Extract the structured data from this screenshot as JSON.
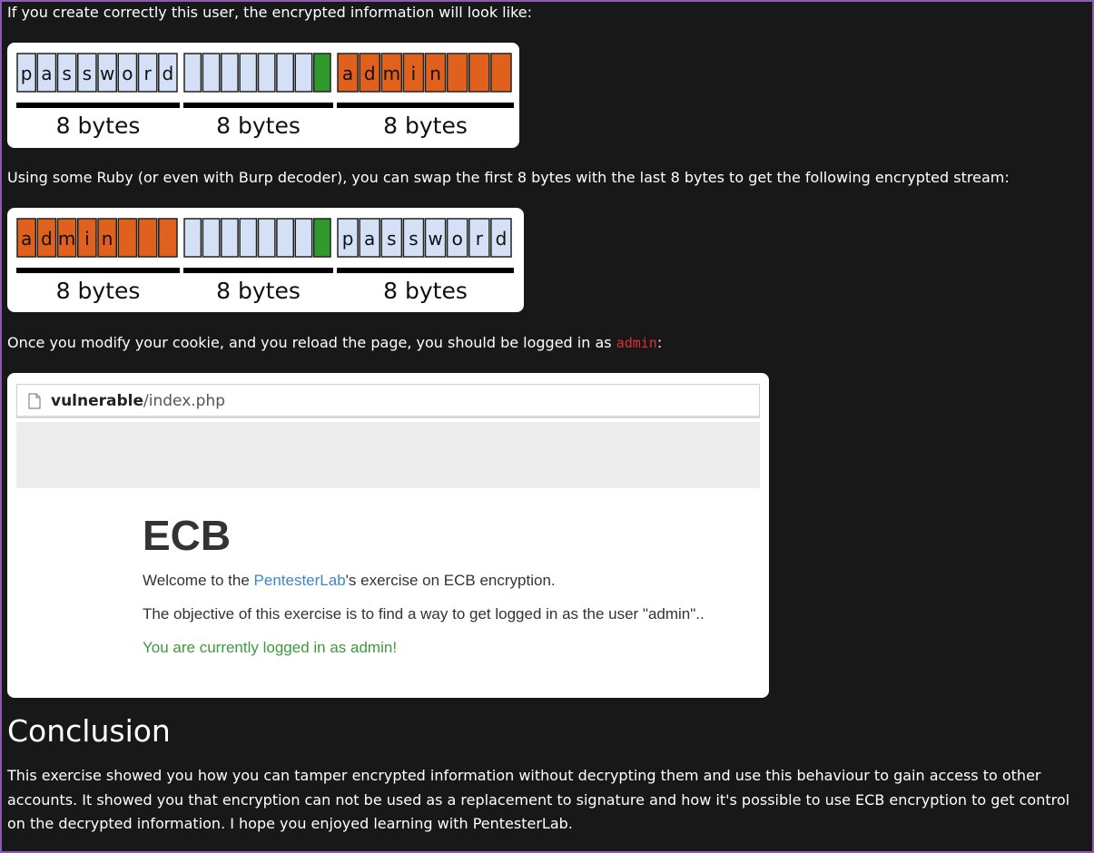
{
  "intro_text": "If you create correctly this user, the encrypted information will look like:",
  "diagram1": {
    "cells": [
      "p",
      "a",
      "s",
      "s",
      "w",
      "o",
      "r",
      "d",
      "",
      "",
      "",
      "",
      "",
      "",
      "",
      "",
      "a",
      "d",
      "m",
      "i",
      "n",
      "",
      "",
      ""
    ],
    "labels": [
      "8 bytes",
      "8 bytes",
      "8 bytes"
    ],
    "colors": {
      "light": "#d3e0f5",
      "green": "#2e9a2e",
      "orange": "#e0601e"
    }
  },
  "swap_text": "Using some Ruby (or even with Burp decoder), you can swap the first 8 bytes with the last 8 bytes to get the following encrypted stream:",
  "diagram2": {
    "cells": [
      "a",
      "d",
      "m",
      "i",
      "n",
      "",
      "",
      "",
      "",
      "",
      "",
      "",
      "",
      "",
      "",
      "",
      "p",
      "a",
      "s",
      "s",
      "w",
      "o",
      "r",
      "d"
    ],
    "labels": [
      "8 bytes",
      "8 bytes",
      "8 bytes"
    ]
  },
  "reload_text_before": "Once you modify your cookie, and you reload the page, you should be logged in as ",
  "reload_code": "admin",
  "reload_text_after": ":",
  "browser": {
    "url_host": "vulnerable",
    "url_path": "/index.php",
    "icon": "page-icon",
    "title": "ECB",
    "welcome_before": "Welcome to the ",
    "welcome_link": "PentesterLab",
    "welcome_after": "'s exercise on ECB encryption.",
    "objective": "The objective of this exercise is to find a way to get logged in as the user \"admin\"..",
    "status": "You are currently logged in as admin!"
  },
  "conclusion": {
    "heading": "Conclusion",
    "body": "This exercise showed you how you can tamper encrypted information without decrypting them and use this behaviour to gain access to other accounts. It showed you that encryption can not be used as a replacement to signature and how it's possible to use ECB encryption to get control on the decrypted information. I hope you enjoyed learning with PentesterLab."
  }
}
